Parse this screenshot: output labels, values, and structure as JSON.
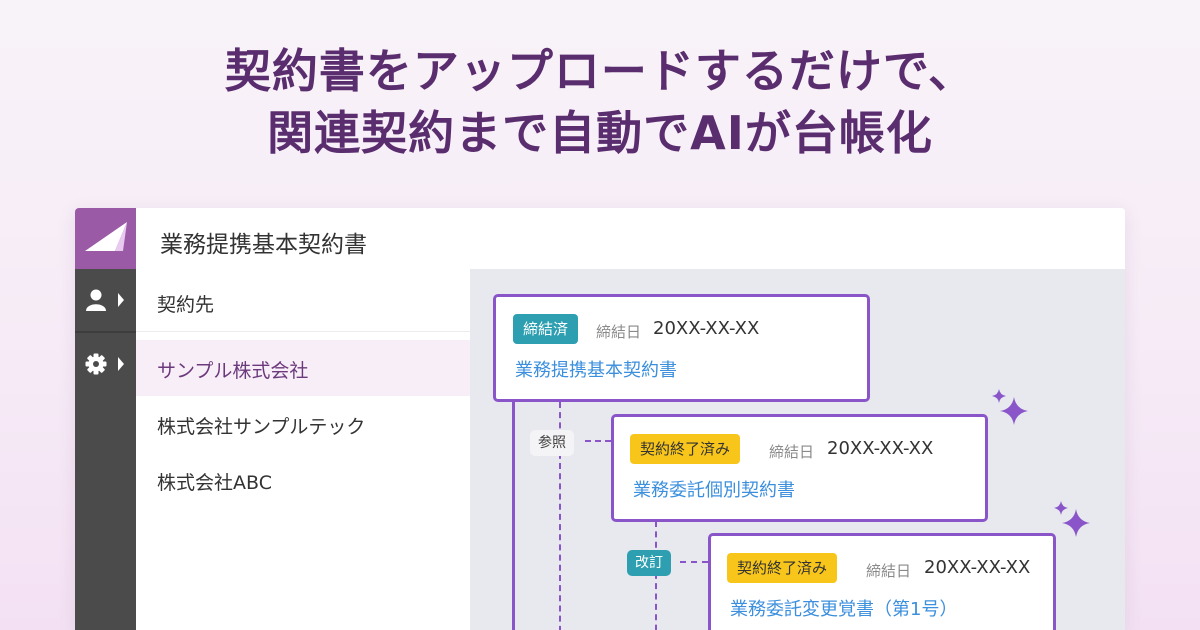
{
  "headline": {
    "line1": "契約書をアップロードするだけで、",
    "line2": "関連契約まで自動でAIが台帳化"
  },
  "header": {
    "title": "業務提携基本契約書"
  },
  "icons": {
    "logo": "logo-mark",
    "nav1": "user-icon",
    "nav2": "gear-icon",
    "sparkle": "sparkle-icon"
  },
  "list": {
    "heading": "契約先",
    "items": [
      "サンプル株式会社",
      "株式会社サンプルテック",
      "株式会社ABC"
    ],
    "selected_index": 0
  },
  "contracts": [
    {
      "status": "締結済",
      "date_label": "締結日",
      "date": "20XX-XX-XX",
      "title": "業務提携基本契約書"
    },
    {
      "status": "契約終了済み",
      "date_label": "締結日",
      "date": "20XX-XX-XX",
      "title": "業務委託個別契約書"
    },
    {
      "status": "契約終了済み",
      "date_label": "締結日",
      "date": "20XX-XX-XX",
      "title": "業務委託変更覚書（第1号）"
    }
  ],
  "relations": [
    "参照",
    "改訂"
  ],
  "colors": {
    "headline": "#5a2d6e",
    "accent": "#8a55c9",
    "teal_badge": "#2e9fb1",
    "yellow_badge": "#f8c61a",
    "link": "#3b8fdd",
    "nav_bg": "#4b4b4b",
    "logo_bg": "#9a5aa6"
  }
}
